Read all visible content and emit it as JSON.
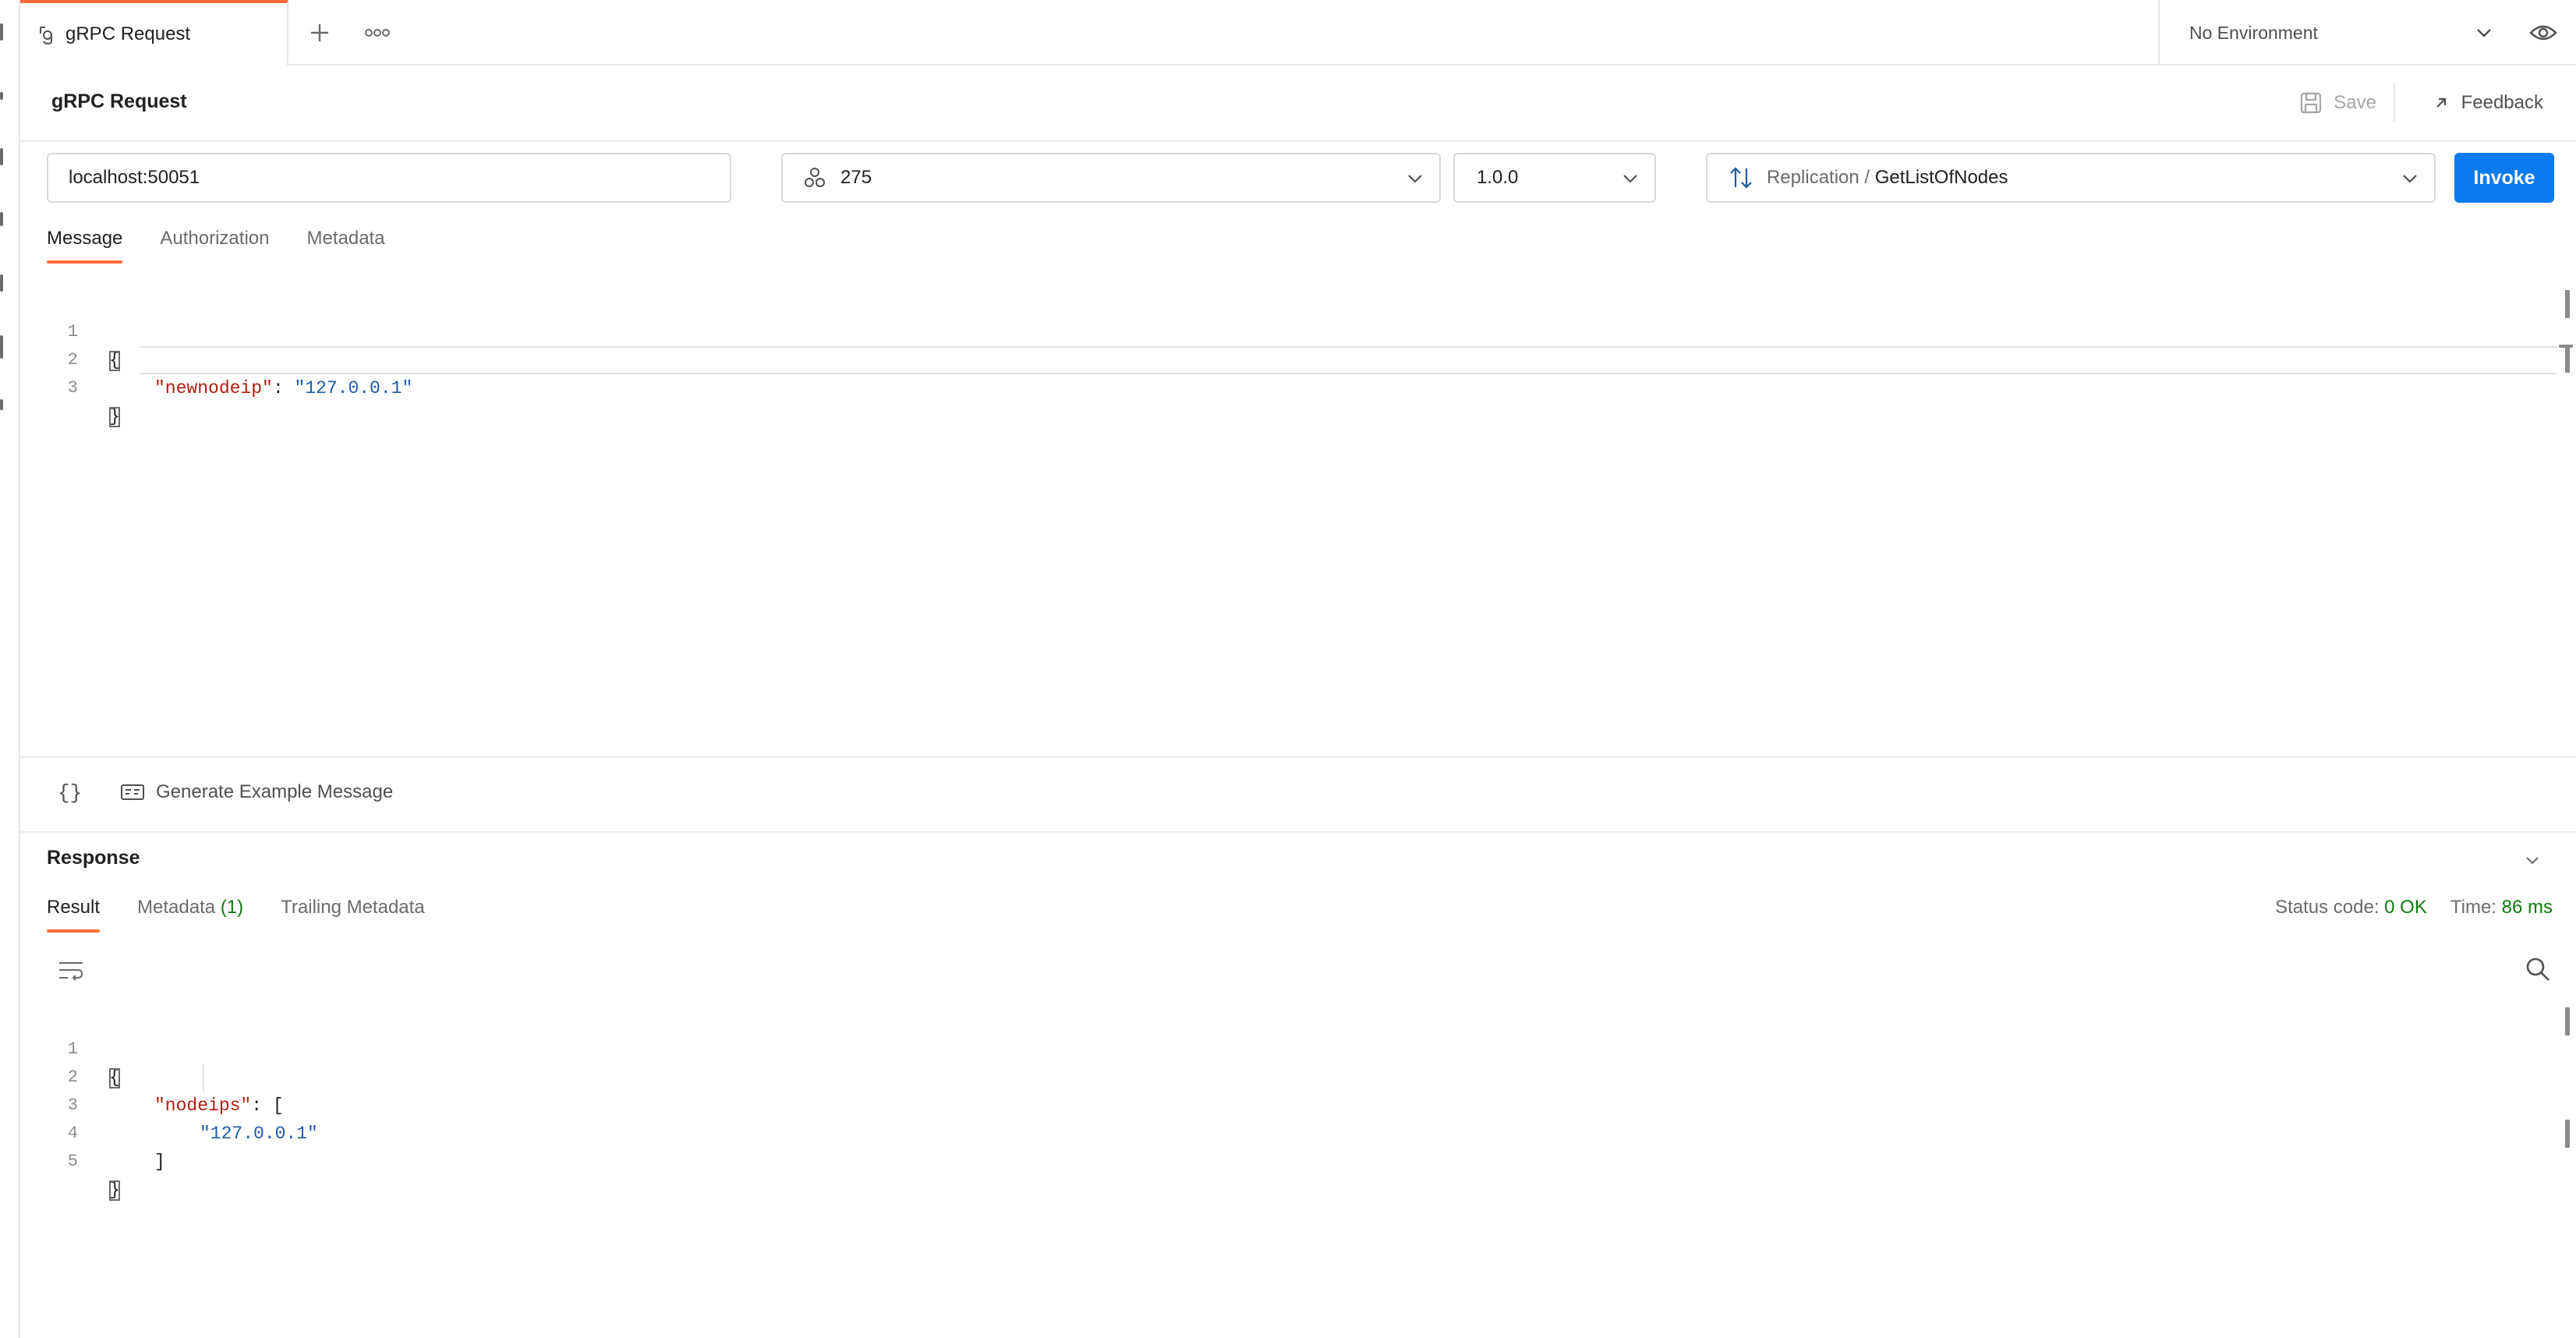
{
  "tab": {
    "label": "gRPC Request",
    "icon": "grpc-icon"
  },
  "tabbar": {
    "add_icon": "plus-icon",
    "more_icon": "more-options-icon"
  },
  "environment": {
    "selected": "No Environment"
  },
  "request": {
    "title": "gRPC Request",
    "save_label": "Save",
    "feedback_label": "Feedback",
    "url": "localhost:50051",
    "proto_selected": "275",
    "version_selected": "1.0.0",
    "method_service": "Replication / ",
    "method_name": "GetListOfNodes",
    "invoke_label": "Invoke"
  },
  "request_tabs": [
    "Message",
    "Authorization",
    "Metadata"
  ],
  "message_editor": {
    "line_numbers": [
      "1",
      "2",
      "3"
    ],
    "open_brace": "{",
    "key": "\"newnodeip\"",
    "separator": ": ",
    "value": "\"127.0.0.1\"",
    "close_brace": "}"
  },
  "message_footer": {
    "braces_label": "{}",
    "generate_label": "Generate Example Message"
  },
  "response": {
    "title": "Response",
    "tabs": {
      "result": "Result",
      "metadata": "Metadata",
      "metadata_count": "(1)",
      "trailing": "Trailing Metadata"
    },
    "status_label": "Status code:",
    "status_value": "0 OK",
    "time_label": "Time:",
    "time_value": "86 ms"
  },
  "response_editor": {
    "line_numbers": [
      "1",
      "2",
      "3",
      "4",
      "5"
    ],
    "open_brace": "{",
    "key": "\"nodeips\"",
    "separator": ": [",
    "value": "\"127.0.0.1\"",
    "close_bracket": "]",
    "close_brace": "}"
  },
  "colors": {
    "accent": "#ff6c37",
    "primary_button": "#097bed",
    "success": "#0f7b0f",
    "json_key": "#b01e0f",
    "json_string": "#1e5aa8"
  }
}
